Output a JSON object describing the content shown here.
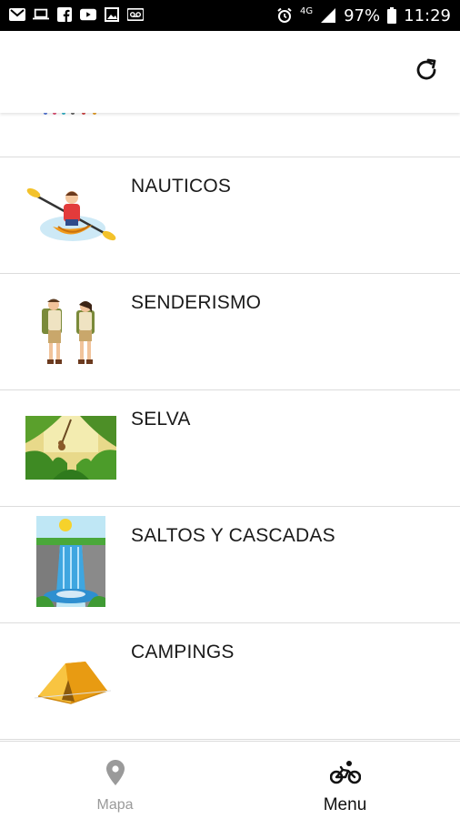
{
  "status_bar": {
    "left_icons": [
      "gmail-icon",
      "laptop-icon",
      "facebook-icon",
      "youtube-icon",
      "gallery-icon",
      "voicemail-icon"
    ],
    "right_icons": [
      "alarm-icon",
      "4g-icon",
      "signal-icon",
      "battery-icon"
    ],
    "network": "4G",
    "battery": "97%",
    "time": "11:29"
  },
  "app_bar": {
    "refresh_icon": "refresh-icon"
  },
  "list": {
    "items": [
      {
        "label": "NAUTICOS",
        "icon": "kayak-illustration"
      },
      {
        "label": "SENDERISMO",
        "icon": "hikers-illustration"
      },
      {
        "label": "SELVA",
        "icon": "jungle-illustration"
      },
      {
        "label": "SALTOS Y CASCADAS",
        "icon": "waterfall-illustration"
      },
      {
        "label": "CAMPINGS",
        "icon": "tent-illustration"
      }
    ]
  },
  "bottom_nav": {
    "items": [
      {
        "label": "Mapa",
        "icon": "map-pin-icon",
        "active": false
      },
      {
        "label": "Menu",
        "icon": "bicycle-icon",
        "active": true
      }
    ],
    "colors": {
      "active": "#111111",
      "inactive": "#9a9a9a"
    }
  }
}
